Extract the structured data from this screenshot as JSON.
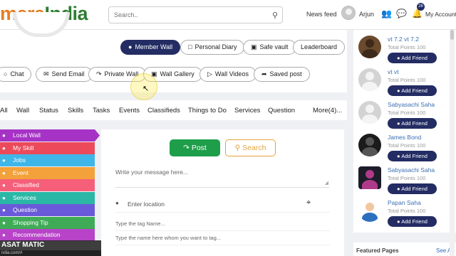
{
  "header": {
    "logo_part1": "mera",
    "logo_part2": "India",
    "search_placeholder": "Search..",
    "news_feed": "News feed",
    "username": "Arjun",
    "notification_count": "26",
    "my_account": "My Account"
  },
  "profile": {
    "actions_row1": [
      "Member Wall",
      "Personal Diary",
      "Safe vault",
      "Leaderboard"
    ],
    "actions_row2": [
      "Chat",
      "Send Email",
      "Private Wall",
      "Wall Gallery",
      "Wall Videos",
      "Saved post"
    ]
  },
  "tabs": [
    "All",
    "Wall",
    "Status",
    "Skills",
    "Tasks",
    "Events",
    "Classifieds",
    "Things to Do",
    "Services",
    "Question",
    "More(4)..."
  ],
  "side_menu": [
    {
      "label": "Local Wall",
      "color": "#a633c6"
    },
    {
      "label": "My Skill",
      "color": "#ec4a5b"
    },
    {
      "label": "Jobs",
      "color": "#3fb6e8"
    },
    {
      "label": "Event",
      "color": "#f3a13a"
    },
    {
      "label": "Classified",
      "color": "#f55f7a"
    },
    {
      "label": "Services",
      "color": "#2bb7a6"
    },
    {
      "label": "Question",
      "color": "#6a5ad9"
    },
    {
      "label": "Shopping Tip",
      "color": "#3fab57"
    },
    {
      "label": "Recommendation",
      "color": "#b843c9"
    }
  ],
  "bottom_overlay": "ASAT MATIC",
  "url_overlay": "ndia.com/#",
  "composer": {
    "post_label": "Post",
    "search_label": "Search",
    "message_placeholder": "Write your message here...",
    "location_placeholder": "Enter location",
    "tag_placeholder": "Type the tag Name...",
    "name_placeholder": "Type the name here whom you want to tag..."
  },
  "suggestions": [
    {
      "name": "vt 7.2 vt 7.2",
      "points": "Total Points 100",
      "button": "Add Friend"
    },
    {
      "name": "vt vt",
      "points": "Total Points 100",
      "button": "Add Friend"
    },
    {
      "name": "Sabyasachi Saha",
      "points": "Total Points 100",
      "button": "Add Friend"
    },
    {
      "name": "James Bond",
      "points": "Total Points 100",
      "button": "Add Friend"
    },
    {
      "name": "Sabyasachi Saha",
      "points": "Total Points 100",
      "button": "Add Friend"
    },
    {
      "name": "Papan Saha",
      "points": "Total Points 100",
      "button": "Add Friend"
    }
  ],
  "featured": {
    "title": "Featured Pages",
    "see_all": "See All"
  }
}
